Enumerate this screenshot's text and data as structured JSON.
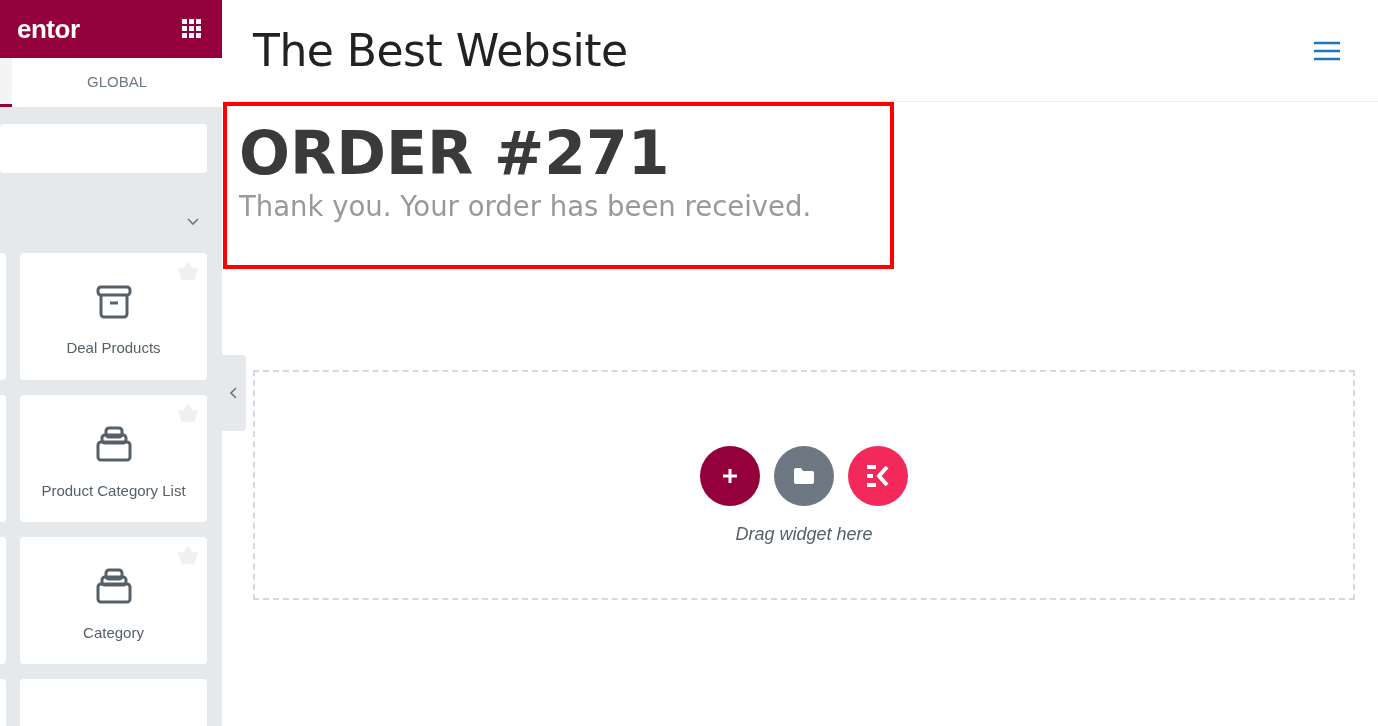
{
  "sidebar": {
    "logo": "entor",
    "tabs": [
      {
        "label": "GLOBAL",
        "selected": false
      }
    ],
    "widgets": [
      {
        "label": "Deal Products",
        "kind": "archive"
      },
      {
        "label": "Product Category List",
        "kind": "stack"
      },
      {
        "label": "Category",
        "kind": "stack"
      }
    ]
  },
  "site": {
    "title": "The Best Website"
  },
  "order": {
    "heading": "ORDER #271",
    "message": "Thank you. Your order has been received."
  },
  "dropzone": {
    "hint": "Drag widget here"
  }
}
